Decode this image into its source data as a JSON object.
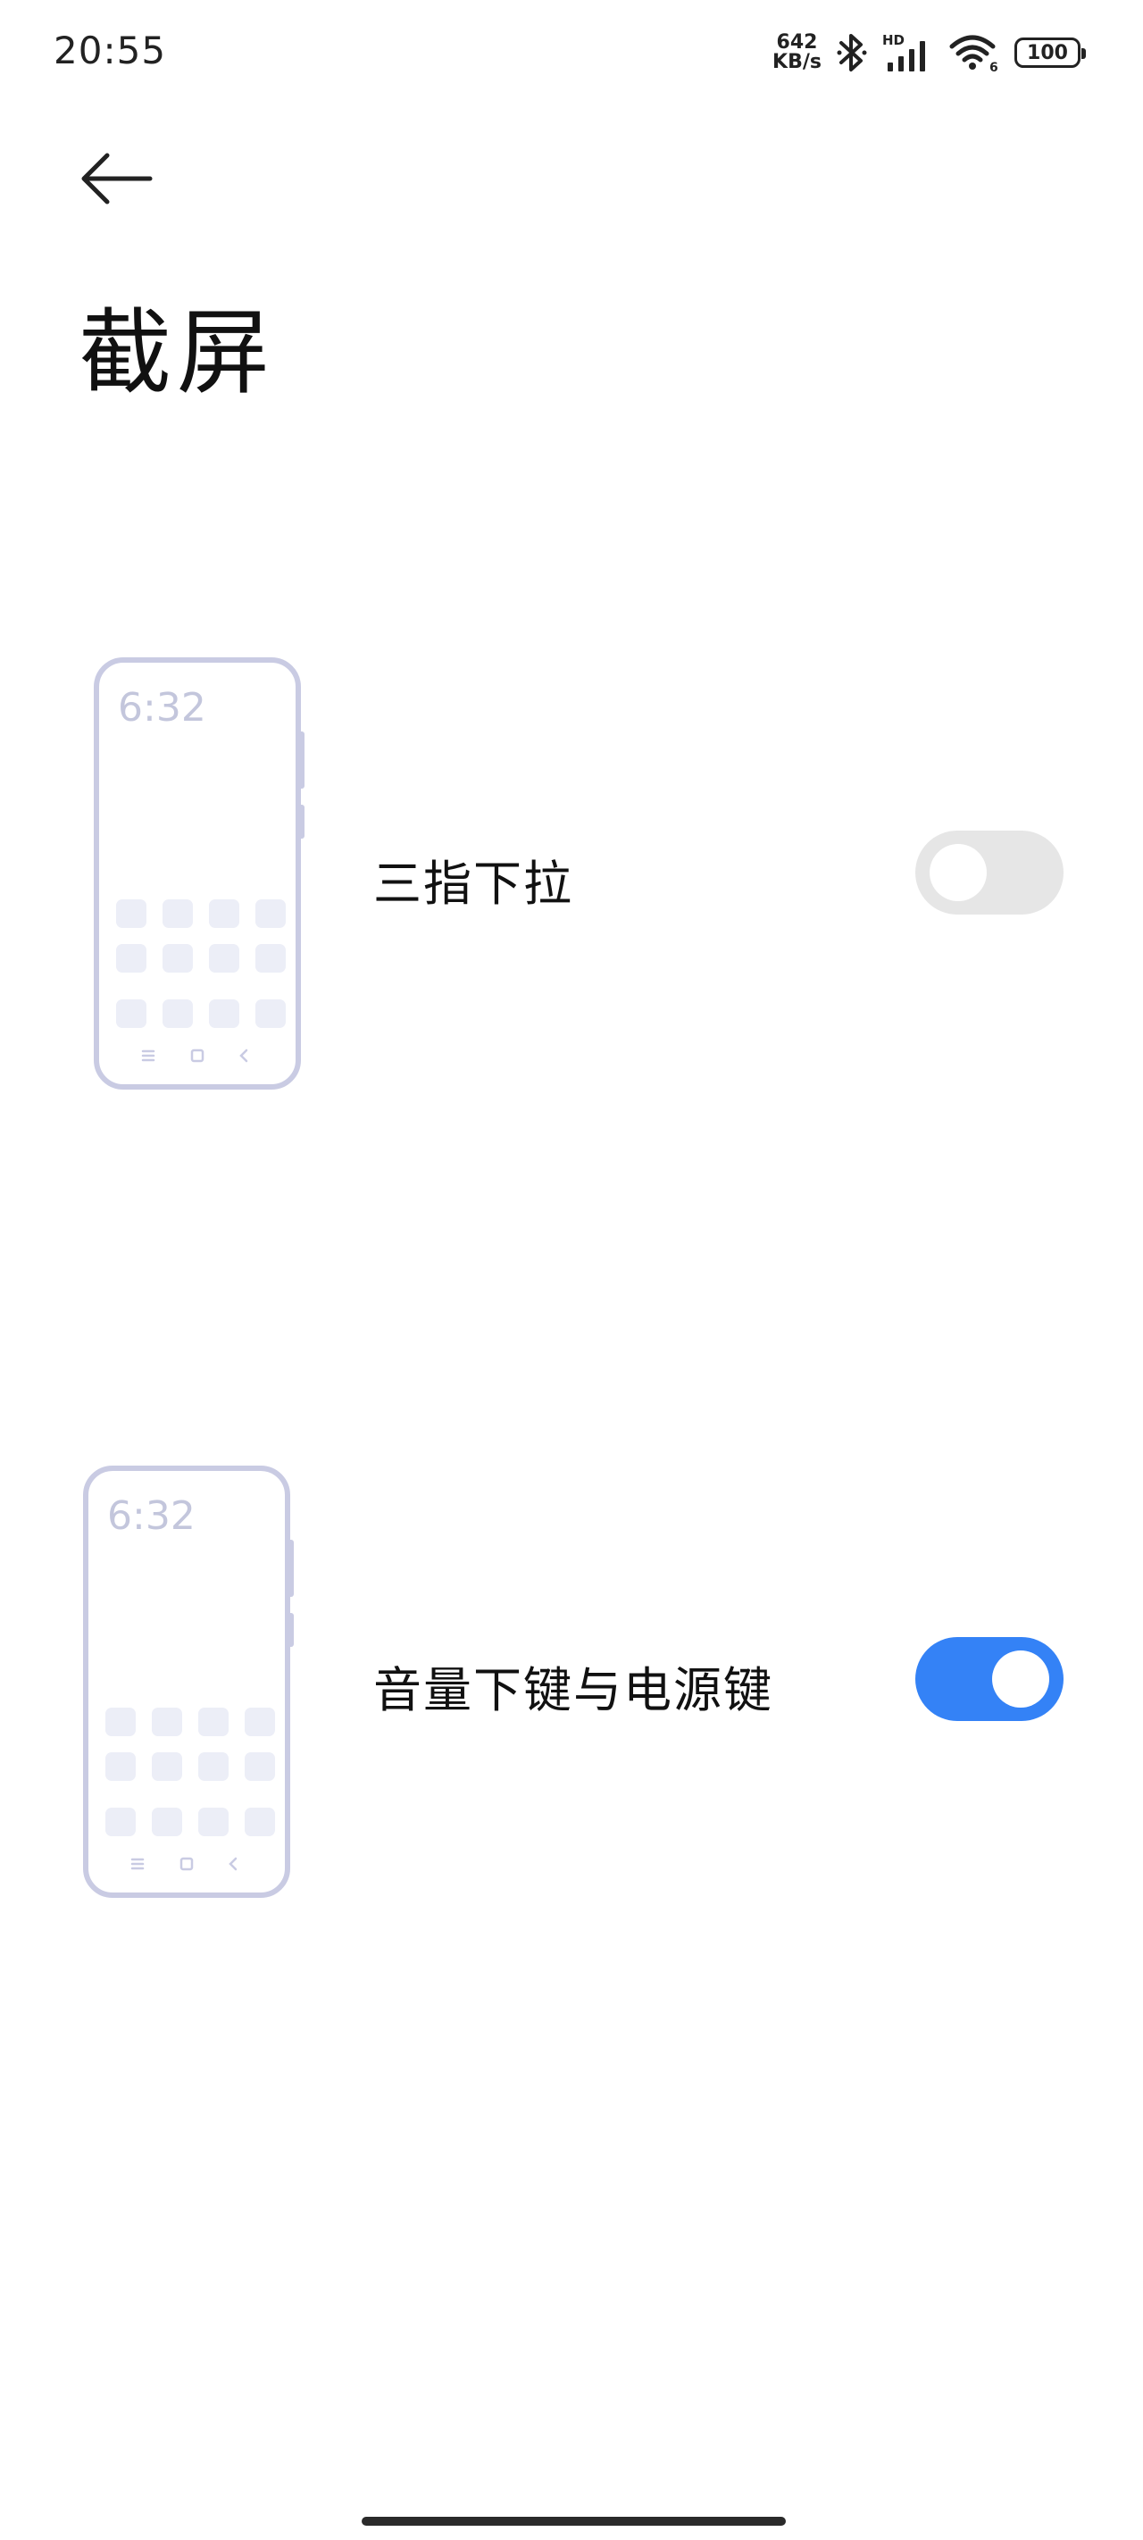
{
  "status_bar": {
    "time": "20:55",
    "net_speed_value": "642",
    "net_speed_unit": "KB/s",
    "signal_label": "HD",
    "wifi_label": "6",
    "battery_level": "100"
  },
  "header": {
    "title": "截屏"
  },
  "options": [
    {
      "label": "三指下拉",
      "enabled": false,
      "preview_time": "6:32"
    },
    {
      "label": "音量下键与电源键",
      "enabled": true,
      "preview_time": "6:32"
    }
  ],
  "colors": {
    "toggle_on": "#3482f6",
    "toggle_off": "#e6e6e6",
    "illustration_stroke": "#c9cbe3",
    "illustration_fill": "#eceef7"
  },
  "icons": {
    "back": "arrow-left-icon",
    "bluetooth": "bluetooth-icon",
    "signal": "cellular-signal-icon",
    "wifi": "wifi-icon",
    "battery": "battery-icon"
  }
}
